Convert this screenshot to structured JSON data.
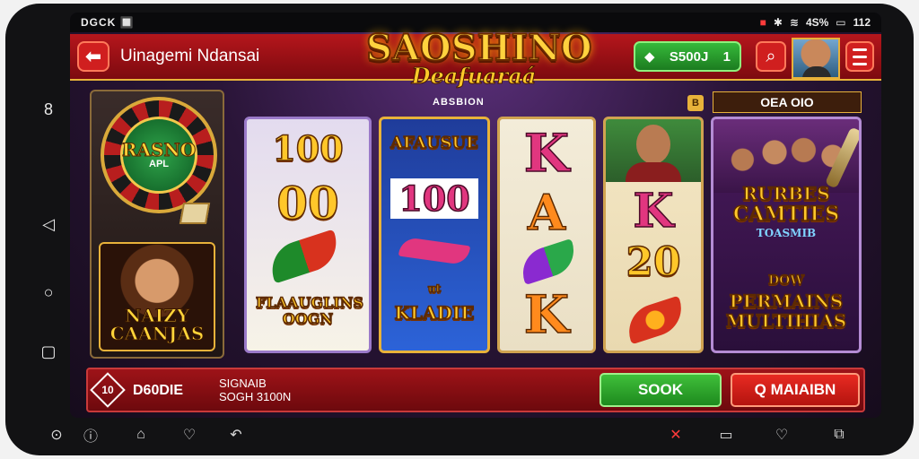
{
  "status_bar": {
    "left_text": "DGCK 🔲",
    "right_text": "4S%",
    "time": "112"
  },
  "header": {
    "back_icon": "arrow-left-icon",
    "title": "Uinagemi Ndansai",
    "logo_main": "SAOSHINO",
    "logo_sub": "Deafuaraá",
    "balance": "S500J",
    "balance_badge": "1",
    "search_icon": "search-icon",
    "menu_icon": "hamburger-icon"
  },
  "left_panel": {
    "wheel_title": "RASNO",
    "wheel_sub": "APL",
    "promo_title_line1": "NAIZY",
    "promo_title_line2": "CAANJAS"
  },
  "main": {
    "header": "ABSBION",
    "info_label": "B",
    "side_title": "OEA OIO",
    "reel1": {
      "top": "100",
      "mid": "00",
      "bottom": "FLAAUGLINS OOGN"
    },
    "reel2": {
      "top": "AFAUSUE",
      "mid": "100",
      "bottom": "KLADIE",
      "bottom_small": "ut"
    },
    "reel3": {
      "top": "K",
      "mid": "A",
      "bottom": "K"
    },
    "reel4": {
      "mid": "K",
      "lower": "20"
    },
    "reel5": {
      "top_title_1": "RURBES",
      "top_title_2": "CAMTIES",
      "top_title_3": "TOASMIB",
      "mid": "DOW",
      "bottom_1": "PERMAINS",
      "bottom_2": "MULTIHIAS"
    }
  },
  "bottom_bar": {
    "diamond_label": "10",
    "bet_code": "D60DIE",
    "stat_line1": "SIGNAIB",
    "stat_line2": "SOGH 3100N",
    "green_button": "SOOK",
    "red_button": "Q MAIAIBN"
  },
  "side_nav": {
    "items": [
      "8",
      "◁",
      "○",
      "▢"
    ]
  },
  "bottom_nav": {
    "items": [
      "⊙",
      "ⓘ",
      "⌂",
      "♡",
      "↶",
      "✕",
      "▭",
      "♡",
      "⧉"
    ]
  },
  "colors": {
    "header_red": "#b5161c",
    "gold": "#e8b23a",
    "green": "#36b93a"
  }
}
